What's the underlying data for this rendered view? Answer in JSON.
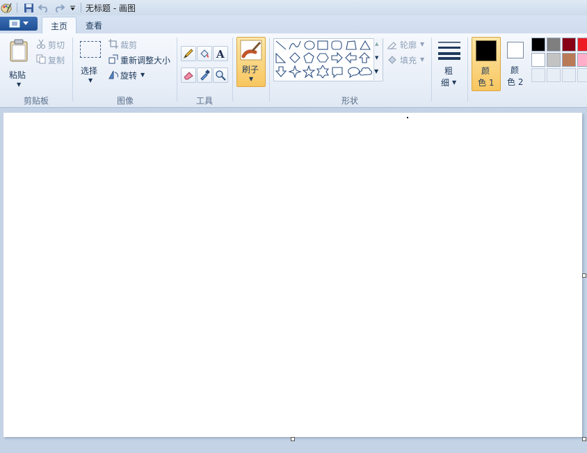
{
  "window": {
    "title": "无标题 - 画图"
  },
  "tabs": [
    {
      "label": "主页",
      "active": true
    },
    {
      "label": "查看",
      "active": false
    }
  ],
  "clipboard": {
    "paste_label": "粘贴",
    "cut_label": "剪切",
    "copy_label": "复制",
    "group_label": "剪贴板"
  },
  "image": {
    "select_label": "选择",
    "crop_label": "裁剪",
    "resize_label": "重新调整大小",
    "rotate_label": "旋转",
    "group_label": "图像"
  },
  "tools": {
    "group_label": "工具"
  },
  "brushes": {
    "label": "刷子"
  },
  "shapes": {
    "outline_label": "轮廓",
    "fill_label": "填充",
    "group_label": "形状"
  },
  "size": {
    "label_line1": "粗",
    "label_line2": "细"
  },
  "colors": {
    "color1_line1": "颜",
    "color1_line2": "色 1",
    "color2_line1": "颜",
    "color2_line2": "色 2",
    "color1_value": "#000000",
    "color2_value": "#ffffff",
    "palette_row1": [
      "#000000",
      "#7f7f7f",
      "#880015",
      "#ed1c24"
    ],
    "palette_row2": [
      "#ffffff",
      "#c3c3c3",
      "#b97a57",
      "#ffaec9"
    ]
  }
}
